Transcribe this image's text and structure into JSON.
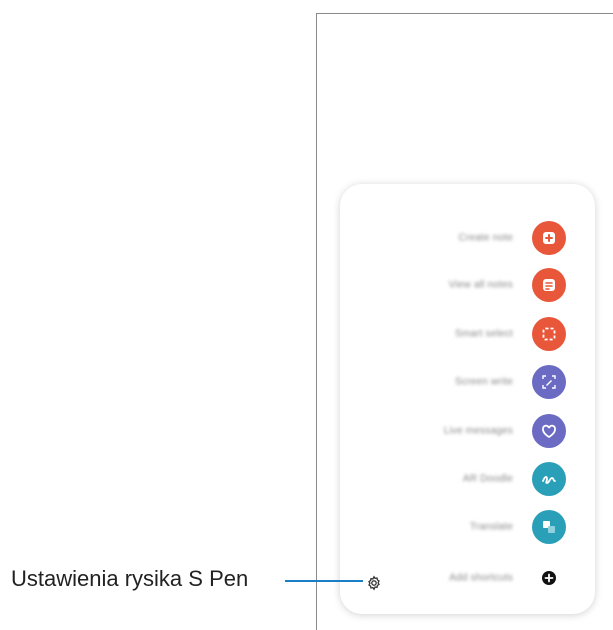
{
  "callout": {
    "label": "Ustawienia rysika S Pen"
  },
  "panel": {
    "items": [
      {
        "label": "Create note",
        "icon": "create-note-icon",
        "color": "#e8573a"
      },
      {
        "label": "View all notes",
        "icon": "view-notes-icon",
        "color": "#e8573a"
      },
      {
        "label": "Smart select",
        "icon": "smart-select-icon",
        "color": "#e8573a"
      },
      {
        "label": "Screen write",
        "icon": "screen-write-icon",
        "color": "#6b6bc4"
      },
      {
        "label": "Live messages",
        "icon": "live-messages-icon",
        "color": "#6b6bc4"
      },
      {
        "label": "AR Doodle",
        "icon": "ar-doodle-icon",
        "color": "#2a9fb8"
      },
      {
        "label": "Translate",
        "icon": "translate-icon",
        "color": "#2a9fb8"
      },
      {
        "label": "Add shortcuts",
        "icon": "add-shortcut-icon",
        "color": "#111111"
      }
    ],
    "settings_icon": "settings-gear-icon"
  }
}
